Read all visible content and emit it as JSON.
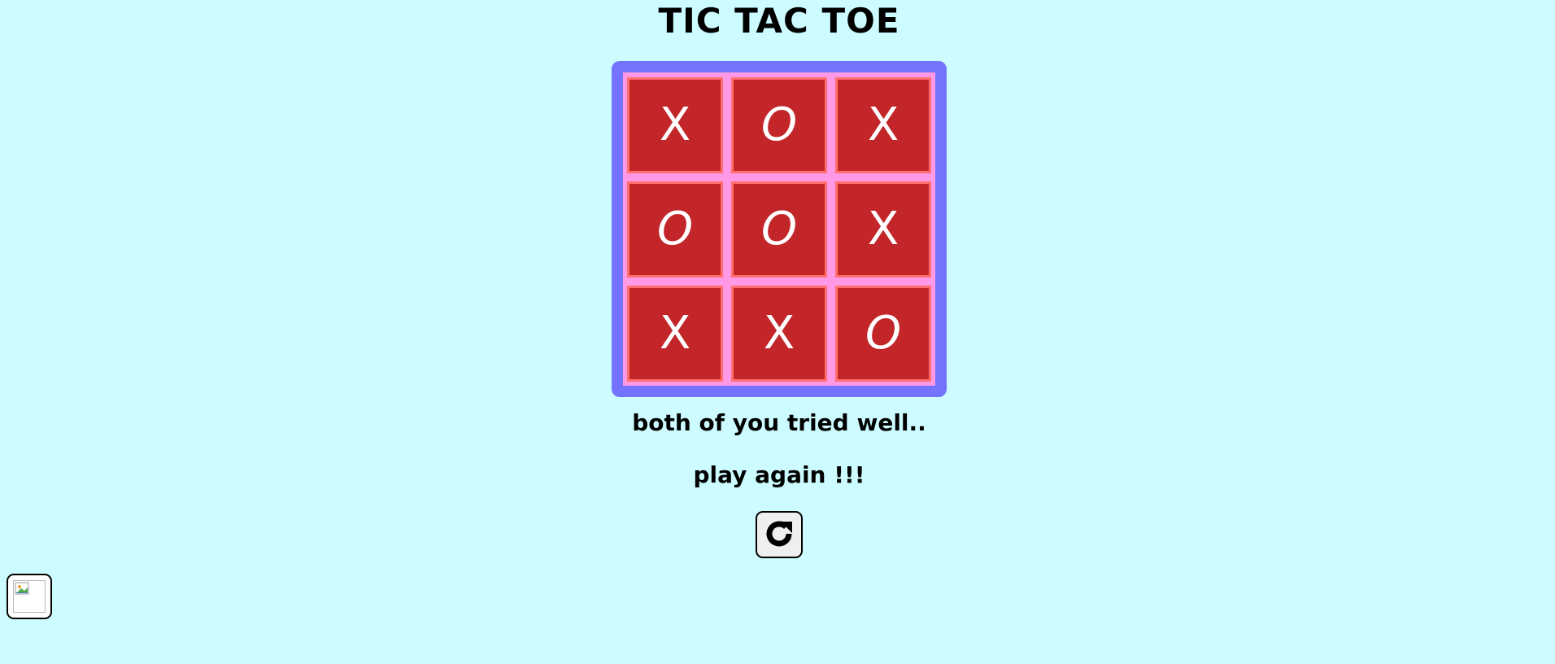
{
  "title": "TIC TAC TOE",
  "board": {
    "cells": [
      "X",
      "O",
      "X",
      "O",
      "O",
      "X",
      "X",
      "X",
      "O"
    ]
  },
  "messages": {
    "result": "both of you tried well..",
    "prompt": "play again !!!"
  },
  "controls": {
    "restart_icon": "refresh-icon",
    "corner_icon": "broken-image-icon"
  },
  "colors": {
    "background": "#ccfcff",
    "board_frame": "#7373fd",
    "board_inner": "#ff99e6",
    "cell_fill": "#c22629",
    "cell_border": "#ff6f6f",
    "mark": "#ffffff"
  }
}
